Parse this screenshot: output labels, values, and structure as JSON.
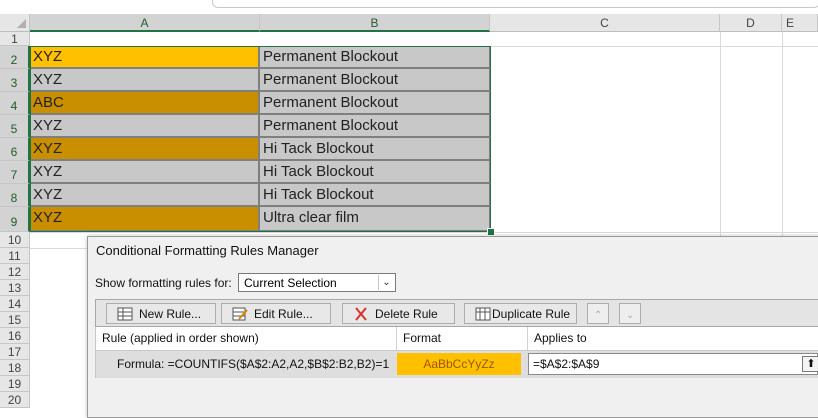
{
  "columns": [
    "A",
    "B",
    "C",
    "D",
    "E"
  ],
  "rows": [
    "1",
    "2",
    "3",
    "4",
    "5",
    "6",
    "7",
    "8",
    "9",
    "10",
    "11",
    "12",
    "13",
    "14",
    "15",
    "16",
    "17",
    "18",
    "19",
    "20"
  ],
  "cells": [
    {
      "a": "XYZ",
      "b": "Permanent Blockout",
      "fill": "#ffc000"
    },
    {
      "a": "XYZ",
      "b": "Permanent Blockout",
      "fill": "#c8c8c8"
    },
    {
      "a": "ABC",
      "b": "Permanent Blockout",
      "fill": "#c98f00"
    },
    {
      "a": "XYZ",
      "b": "Permanent Blockout",
      "fill": "#c8c8c8"
    },
    {
      "a": "XYZ",
      "b": "Hi Tack Blockout",
      "fill": "#c98f00"
    },
    {
      "a": "XYZ",
      "b": "Hi Tack Blockout",
      "fill": "#c8c8c8"
    },
    {
      "a": "XYZ",
      "b": "Hi Tack Blockout",
      "fill": "#c8c8c8"
    },
    {
      "a": "XYZ",
      "b": "Ultra clear film",
      "fill": "#c98f00"
    }
  ],
  "colors": {
    "grey_fill": "#c8c8c8",
    "accent_green": "#217346",
    "format_fill": "#ffc000"
  },
  "dialog": {
    "title": "Conditional Formatting Rules Manager",
    "show_rules_label": "Show formatting rules for:",
    "show_rules_value": "Current Selection",
    "buttons": {
      "new_rule": "New Rule...",
      "edit_rule": "Edit Rule...",
      "delete_rule": "Delete Rule",
      "duplicate_rule": "Duplicate Rule"
    },
    "headers": {
      "rule": "Rule (applied in order shown)",
      "format": "Format",
      "applies_to": "Applies to"
    },
    "rule": {
      "formula": "Formula: =COUNTIFS($A$2:A2,A2,$B$2:B2,B2)=1",
      "format_preview": "AaBbCcYyZz",
      "applies_to": "=$A$2:$A$9"
    }
  }
}
